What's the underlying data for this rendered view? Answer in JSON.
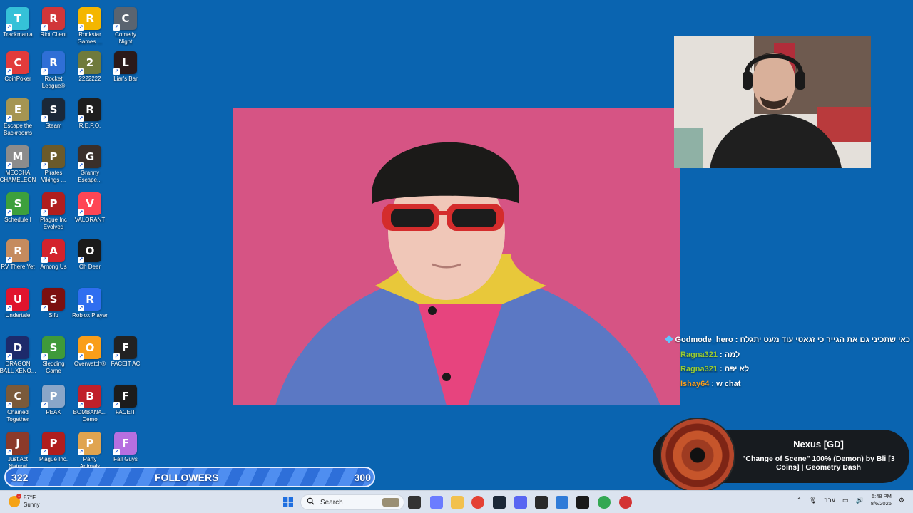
{
  "desktop_icons": [
    {
      "label": "Trackmania",
      "icon": "trackmania-icon",
      "color": "#35c1d8"
    },
    {
      "label": "Riot Client",
      "icon": "riot-client-icon",
      "color": "#d13639"
    },
    {
      "label": "Rockstar\nGames ...",
      "icon": "rockstar-icon",
      "color": "#f4b600"
    },
    {
      "label": "Comedy\nNight",
      "icon": "microphone-icon",
      "color": "#5a6470"
    },
    {
      "label": "CoinPoker",
      "icon": "coinpoker-icon",
      "color": "#e23b3b"
    },
    {
      "label": "Rocket\nLeague®",
      "icon": "rocket-league-icon",
      "color": "#2f6fd6"
    },
    {
      "label": "2222222",
      "icon": "game-2222222-icon",
      "color": "#6f7a3c"
    },
    {
      "label": "Liar's Bar",
      "icon": "liars-bar-icon",
      "color": "#2b1a1a"
    },
    {
      "label": "Escape the\nBackrooms",
      "icon": "escape-backrooms-icon",
      "color": "#a59552"
    },
    {
      "label": "Steam",
      "icon": "steam-icon",
      "color": "#1b2838"
    },
    {
      "label": "R.E.P.O.",
      "icon": "repo-icon",
      "color": "#1e1e1e"
    },
    {
      "label": "MECCHA\nCHAMELEON",
      "icon": "meccha-chameleon-icon",
      "color": "#8c8c8c"
    },
    {
      "label": "Pirates\nVikings ...",
      "icon": "pirates-vikings-icon",
      "color": "#6b5a2a"
    },
    {
      "label": "Granny\nEscape...",
      "icon": "granny-escape-icon",
      "color": "#3a2f2a"
    },
    {
      "label": "Schedule I",
      "icon": "schedule-i-icon",
      "color": "#3da03d"
    },
    {
      "label": "Plague Inc\nEvolved",
      "icon": "plague-inc-evolved-icon",
      "color": "#b01e1e"
    },
    {
      "label": "VALORANT",
      "icon": "valorant-icon",
      "color": "#ff4655"
    },
    {
      "label": "RV There Yet",
      "icon": "rv-there-yet-icon",
      "color": "#c58b5e"
    },
    {
      "label": "Among Us",
      "icon": "among-us-icon",
      "color": "#d3232d"
    },
    {
      "label": "Oh Deer",
      "icon": "oh-deer-icon",
      "color": "#1a1a1a"
    },
    {
      "label": "Undertale",
      "icon": "heart-icon",
      "color": "#e0142d"
    },
    {
      "label": "Sifu",
      "icon": "sifu-icon",
      "color": "#7b1010"
    },
    {
      "label": "Roblox Player",
      "icon": "roblox-icon",
      "color": "#2f6ef0"
    },
    {
      "label": "DRAGON\nBALL XENO...",
      "icon": "dragon-ball-icon",
      "color": "#1d2a6b"
    },
    {
      "label": "Sledding\nGame",
      "icon": "frog-icon",
      "color": "#3f9a3a"
    },
    {
      "label": "Overwatch®",
      "icon": "overwatch-icon",
      "color": "#f99e1a"
    },
    {
      "label": "FACEIT AC",
      "icon": "faceit-ac-icon",
      "color": "#222222"
    },
    {
      "label": "Chained\nTogether",
      "icon": "chained-together-icon",
      "color": "#7a5a3a"
    },
    {
      "label": "PEAK",
      "icon": "peak-icon",
      "color": "#8aa6c8"
    },
    {
      "label": "BOMBANA...\nDemo",
      "icon": "bombana-icon",
      "color": "#c0202a"
    },
    {
      "label": "FACEIT",
      "icon": "faceit-icon",
      "color": "#1c1c1c"
    },
    {
      "label": "Just Act\nNatural",
      "icon": "just-act-natural-icon",
      "color": "#8b3a2a"
    },
    {
      "label": "Plague Inc.",
      "icon": "plague-inc-icon",
      "color": "#b01e1e"
    },
    {
      "label": "Party\nAnimals",
      "icon": "party-animals-icon",
      "color": "#e0a450"
    },
    {
      "label": "Fall Guys",
      "icon": "fall-guys-icon",
      "color": "#b66fe0"
    }
  ],
  "chat": {
    "messages": [
      {
        "user": "Godmode_hero",
        "text": "כאי שתכיני גם את הגייר כי זגאטי עוד מעט יתגלח",
        "user_color": "#ffffff",
        "badge": true,
        "rtl": true
      },
      {
        "user": "Ragna321",
        "text": "למה",
        "user_color": "#9acd32"
      },
      {
        "user": "Ragna321",
        "text": "לא יפה",
        "user_color": "#9acd32"
      },
      {
        "user": "Ishay64",
        "text": "w chat",
        "user_color": "#ff9f1a"
      }
    ]
  },
  "now_playing": {
    "title": "Nexus [GD]",
    "subtitle": "\"Change of Scene\" 100% (Demon) by Bli [3 Coins] | Geometry Dash"
  },
  "followers": {
    "current": "322",
    "label": "FOLLOWERS",
    "goal": "300"
  },
  "taskbar": {
    "weather_temp": "87°F",
    "weather_desc": "Sunny",
    "weather_alert": "1",
    "search_placeholder": "Search",
    "language": "עבר",
    "time": "5:48 PM",
    "date": "8/6/2026",
    "apps": [
      {
        "icon": "windows-start-icon",
        "color": "#1f6fe0",
        "interactable": true
      },
      {
        "icon": "task-view-icon",
        "color": "#333333"
      },
      {
        "icon": "copilot-icon",
        "color": "#6b7cff"
      },
      {
        "icon": "file-explorer-icon",
        "color": "#f2c14e"
      },
      {
        "icon": "chrome-icon",
        "color": "#e44134"
      },
      {
        "icon": "steam-icon",
        "color": "#1b2838"
      },
      {
        "icon": "discord-icon",
        "color": "#5865f2"
      },
      {
        "icon": "epic-games-icon",
        "color": "#2a2a2a"
      },
      {
        "icon": "snipping-tool-icon",
        "color": "#2f7bd8"
      },
      {
        "icon": "obs-icon",
        "color": "#1a1a1a"
      },
      {
        "icon": "chrome-alt-icon",
        "color": "#34a853"
      },
      {
        "icon": "red-app-icon",
        "color": "#d33333"
      }
    ]
  }
}
